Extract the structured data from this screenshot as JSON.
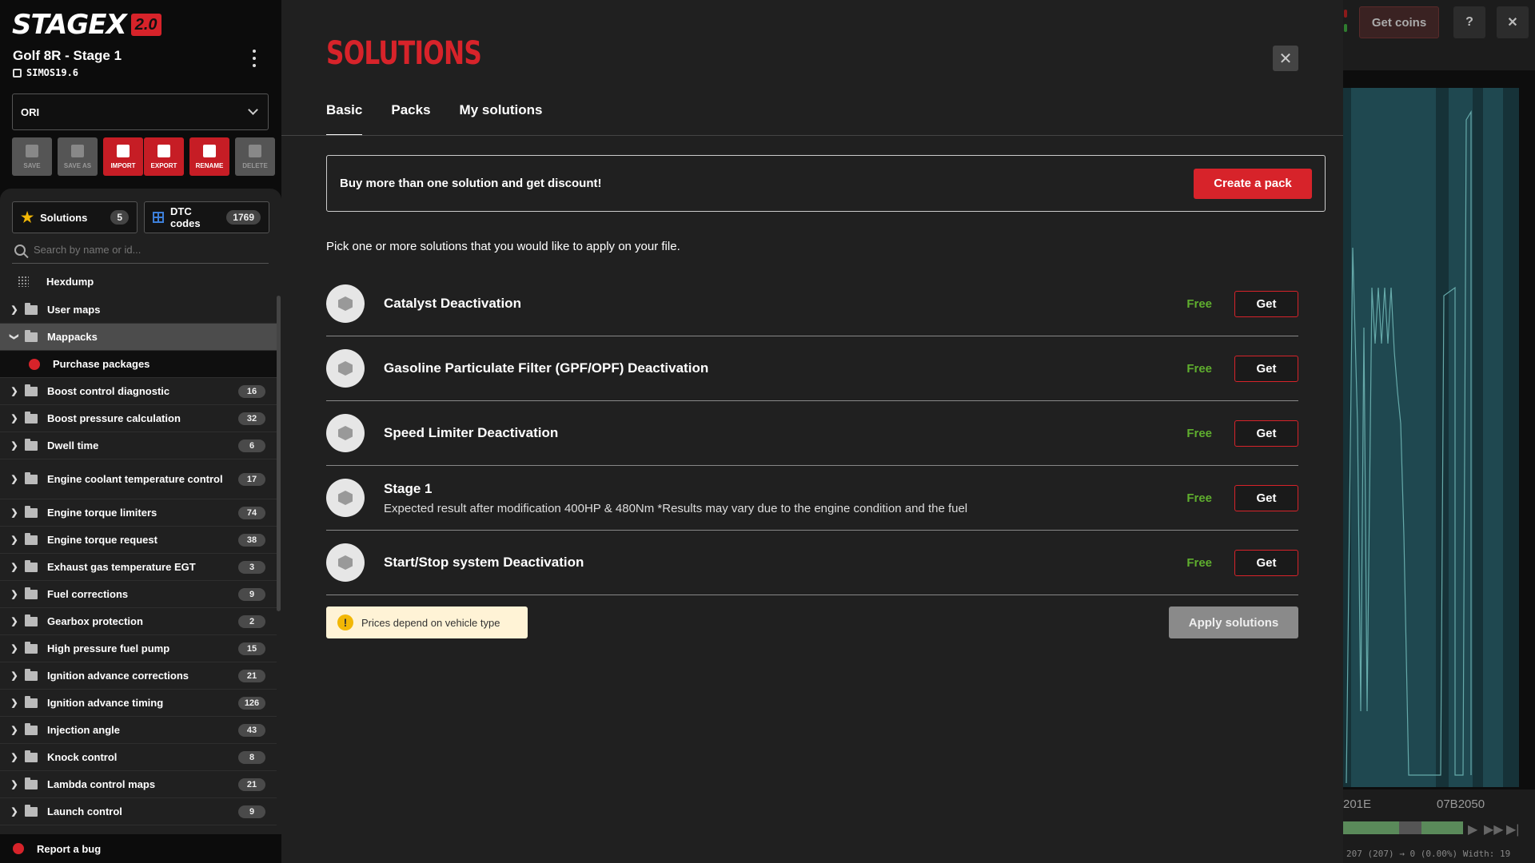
{
  "brand": {
    "name": "STAGEX",
    "version": "2.0",
    "accent": "#d7232a"
  },
  "project": {
    "title": "Golf 8R - Stage 1",
    "ecu": "SIMOS19.6"
  },
  "file_select": {
    "value": "ORI"
  },
  "toolbar": {
    "save": "SAVE",
    "save_as": "SAVE AS",
    "import": "IMPORT",
    "export": "EXPORT",
    "rename": "RENAME",
    "delete": "DELETE"
  },
  "panel_tabs": {
    "solutions": {
      "label": "Solutions",
      "count": "5"
    },
    "dtc": {
      "label": "DTC codes",
      "count": "1769"
    }
  },
  "search": {
    "placeholder": "Search by name or id..."
  },
  "tree": {
    "hexdump": "Hexdump",
    "user_maps": "User maps",
    "mappacks": "Mappacks",
    "purchase": "Purchase packages",
    "items": [
      {
        "label": "Boost control diagnostic",
        "count": "16"
      },
      {
        "label": "Boost pressure calculation",
        "count": "32"
      },
      {
        "label": "Dwell time",
        "count": "6"
      },
      {
        "label": "Engine coolant temperature control",
        "count": "17"
      },
      {
        "label": "Engine torque limiters",
        "count": "74"
      },
      {
        "label": "Engine torque request",
        "count": "38"
      },
      {
        "label": "Exhaust gas temperature EGT",
        "count": "3"
      },
      {
        "label": "Fuel corrections",
        "count": "9"
      },
      {
        "label": "Gearbox protection",
        "count": "2"
      },
      {
        "label": "High pressure fuel pump",
        "count": "15"
      },
      {
        "label": "Ignition advance corrections",
        "count": "21"
      },
      {
        "label": "Ignition advance timing",
        "count": "126"
      },
      {
        "label": "Injection angle",
        "count": "43"
      },
      {
        "label": "Knock control",
        "count": "8"
      },
      {
        "label": "Lambda control maps",
        "count": "21"
      },
      {
        "label": "Launch control",
        "count": "9"
      }
    ]
  },
  "report": "Report a bug",
  "topbar": {
    "get_coins": "Get coins",
    "help": "?",
    "close": "✕"
  },
  "background": {
    "axis_left": "201E",
    "axis_right": "07B2050",
    "status": "207 (207) → 0 (0.00%) Width: 19"
  },
  "modal": {
    "title": "SOLUTIONS",
    "tabs": [
      "Basic",
      "Packs",
      "My solutions"
    ],
    "banner_text": "Buy more than one solution and get discount!",
    "banner_button": "Create a pack",
    "intro": "Pick one or more solutions that you would like to apply on your file.",
    "solutions": [
      {
        "name": "Catalyst Deactivation",
        "desc": "",
        "price": "Free",
        "action": "Get"
      },
      {
        "name": "Gasoline Particulate Filter (GPF/OPF) Deactivation",
        "desc": "",
        "price": "Free",
        "action": "Get"
      },
      {
        "name": "Speed Limiter Deactivation",
        "desc": "",
        "price": "Free",
        "action": "Get"
      },
      {
        "name": "Stage 1",
        "desc": "Expected result after modification 400HP & 480Nm *Results may vary due to the engine condition and the fuel",
        "price": "Free",
        "action": "Get"
      },
      {
        "name": "Start/Stop system Deactivation",
        "desc": "",
        "price": "Free",
        "action": "Get"
      }
    ],
    "notice": "Prices depend on vehicle type",
    "apply": "Apply solutions"
  }
}
